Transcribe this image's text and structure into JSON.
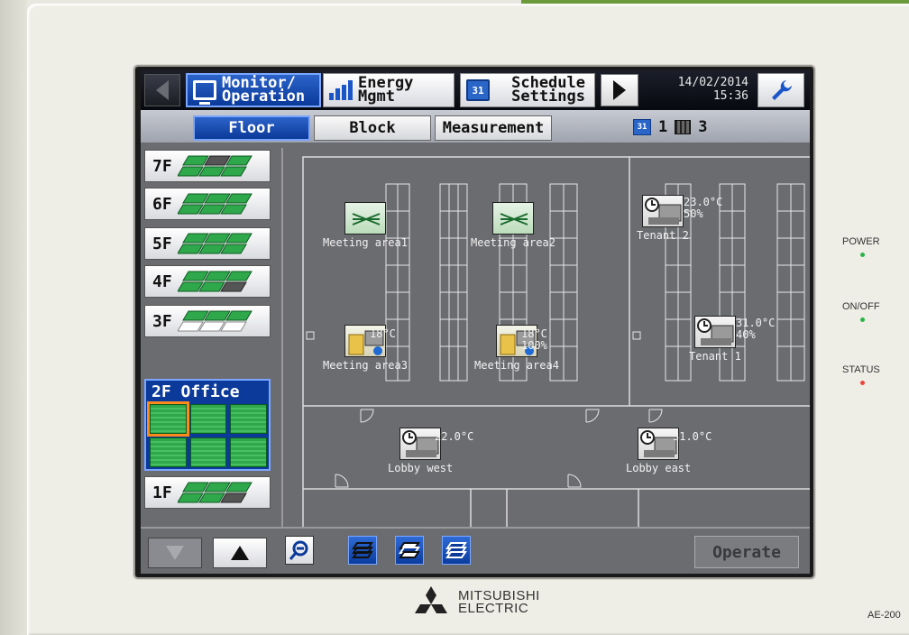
{
  "topbar": {
    "monitor_line1": "Monitor/",
    "monitor_line2": "Operation",
    "energy_line1": "Energy",
    "energy_line2": "Mgmt",
    "schedule_line1": "Schedule",
    "schedule_line2": "Settings",
    "schedule_icon_text": "31",
    "date": "14/02/2014",
    "time": "15:36"
  },
  "tabs": [
    {
      "label": "Floor",
      "active": true
    },
    {
      "label": "Block",
      "active": false
    },
    {
      "label": "Measurement",
      "active": false
    }
  ],
  "counts": {
    "schedule_icon_text": "31",
    "schedule_count": "1",
    "group_count": "3"
  },
  "floors": [
    {
      "label": "7F"
    },
    {
      "label": "6F"
    },
    {
      "label": "5F"
    },
    {
      "label": "4F"
    },
    {
      "label": "3F"
    },
    {
      "label": "2F Office",
      "active": true
    },
    {
      "label": "1F"
    }
  ],
  "units": [
    {
      "name": "Meeting area1",
      "reading_line1": "",
      "reading_line2": "",
      "icon": "ventilator-icon"
    },
    {
      "name": "Meeting area2",
      "reading_line1": "",
      "reading_line2": "",
      "icon": "ventilator-icon"
    },
    {
      "name": "Tenant 2",
      "reading_line1": "23.0°C",
      "reading_line2": "50%",
      "icon": "indoor-unit-icon"
    },
    {
      "name": "Meeting area3",
      "reading_line1": "18°C",
      "reading_line2": "",
      "icon": "indoor-unit-icon"
    },
    {
      "name": "Meeting area4",
      "reading_line1": "18°C",
      "reading_line2": "100%",
      "icon": "indoor-unit-icon"
    },
    {
      "name": "Tenant 1",
      "reading_line1": "31.0°C",
      "reading_line2": "40%",
      "icon": "indoor-unit-icon"
    },
    {
      "name": "Lobby west",
      "reading_line1": "22.0°C",
      "reading_line2": "",
      "icon": "indoor-unit-icon"
    },
    {
      "name": "Lobby east",
      "reading_line1": "31.0°C",
      "reading_line2": "",
      "icon": "indoor-unit-icon"
    }
  ],
  "bottombar": {
    "operate_label": "Operate"
  },
  "indicators": {
    "power": "POWER",
    "onoff": "ON/OFF",
    "status": "STATUS"
  },
  "brand": {
    "line1": "MITSUBISHI",
    "line2": "ELECTRIC",
    "model": "AE-200"
  },
  "colors": {
    "accent_blue": "#0b3a9a",
    "unit_green": "#2ea84a",
    "selection_orange": "#ff8a1c",
    "led_green": "#2db24a",
    "led_red": "#e8483a"
  }
}
